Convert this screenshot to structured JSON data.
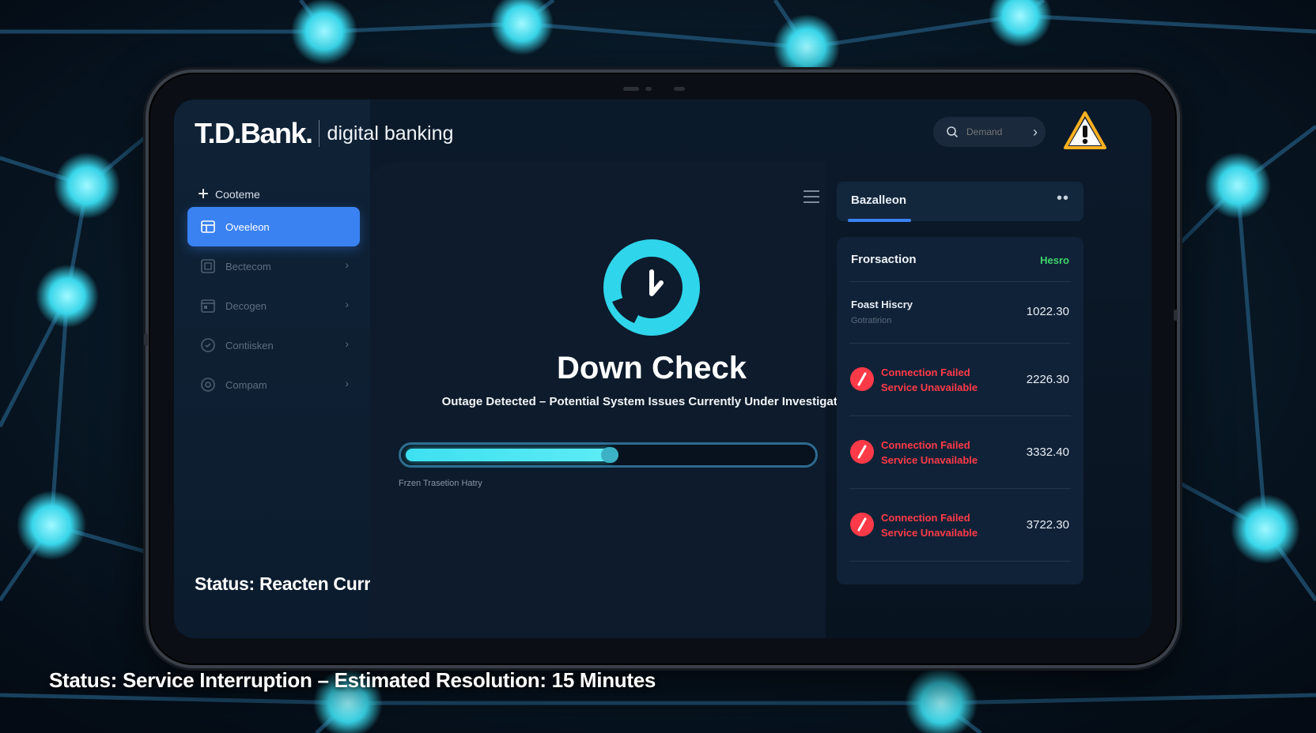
{
  "footer_status": "Status: Service Interruption – Estimated Resolution: 15 Minutes",
  "app": {
    "brand_name": "T.D.Bank.",
    "brand_sub": "digital banking",
    "status_line": "Status: Reacten Currently Under Investigation"
  },
  "header": {
    "search_placeholder": "Demand",
    "alert_icon": "warning-triangle-icon"
  },
  "sidebar": {
    "new_label": "Cooteme",
    "items": [
      {
        "label": "Oveeleon",
        "icon": "dashboard-icon",
        "active": true
      },
      {
        "label": "Bectecom",
        "icon": "square-icon",
        "active": false
      },
      {
        "label": "Decogen",
        "icon": "calendar-icon",
        "active": false
      },
      {
        "label": "Contiisken",
        "icon": "shield-icon",
        "active": false
      },
      {
        "label": "Compam",
        "icon": "settings-icon",
        "active": false
      }
    ]
  },
  "main": {
    "headline": "Down Check",
    "subline": "Outage Detected – Potential System Issues Currently Under Investigation.",
    "progress_percent": 51,
    "progress_label": "Frzen Trasetion Hatry"
  },
  "right": {
    "tab_label": "Bazalleon",
    "tx_header": "Frorsaction",
    "tx_badge": "Hesro",
    "transactions": [
      {
        "title": "Foast Hiscry",
        "subtitle": "Gotratirion",
        "amount": "1022.30"
      },
      {
        "line1": "Connection Failed",
        "line2": "Service Unavailable",
        "amount": "2226.30"
      },
      {
        "line1": "Connection Failed",
        "line2": "Service Unavailable",
        "amount": "3332.40"
      },
      {
        "line1": "Connection Failed",
        "line2": "Service Unavailable",
        "amount": "3722.30"
      }
    ]
  },
  "colors": {
    "accent": "#3a82f2",
    "cyan": "#3ee0f0",
    "error": "#ff3a48",
    "success": "#3fd46a",
    "warning": "#ffb020"
  }
}
